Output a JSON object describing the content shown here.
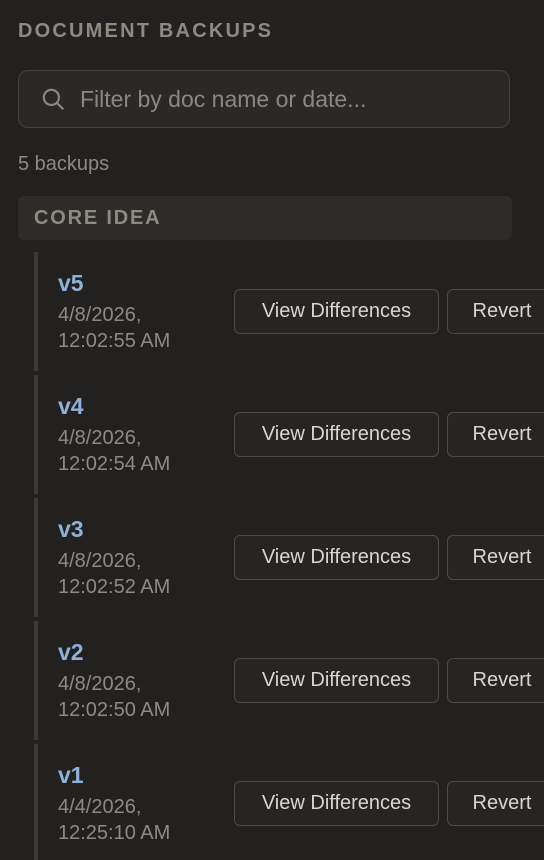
{
  "panel": {
    "title": "DOCUMENT BACKUPS"
  },
  "search": {
    "placeholder": "Filter by doc name or date...",
    "value": "",
    "icon": "search-icon"
  },
  "count_label": "5 backups",
  "group": {
    "name": "CORE IDEA"
  },
  "backups": [
    {
      "version": "v5",
      "date": "4/8/2026,",
      "time": "12:02:55 AM",
      "view_label": "View Differences",
      "revert_label": "Revert"
    },
    {
      "version": "v4",
      "date": "4/8/2026,",
      "time": "12:02:54 AM",
      "view_label": "View Differences",
      "revert_label": "Revert"
    },
    {
      "version": "v3",
      "date": "4/8/2026,",
      "time": "12:02:52 AM",
      "view_label": "View Differences",
      "revert_label": "Revert"
    },
    {
      "version": "v2",
      "date": "4/8/2026,",
      "time": "12:02:50 AM",
      "view_label": "View Differences",
      "revert_label": "Revert"
    },
    {
      "version": "v1",
      "date": "4/4/2026,",
      "time": "12:25:10 AM",
      "view_label": "View Differences",
      "revert_label": "Revert"
    }
  ],
  "colors": {
    "background": "#22211f",
    "version_accent": "#8fb1d9",
    "muted_text": "#8d8a84",
    "button_border": "#4d4b47"
  }
}
